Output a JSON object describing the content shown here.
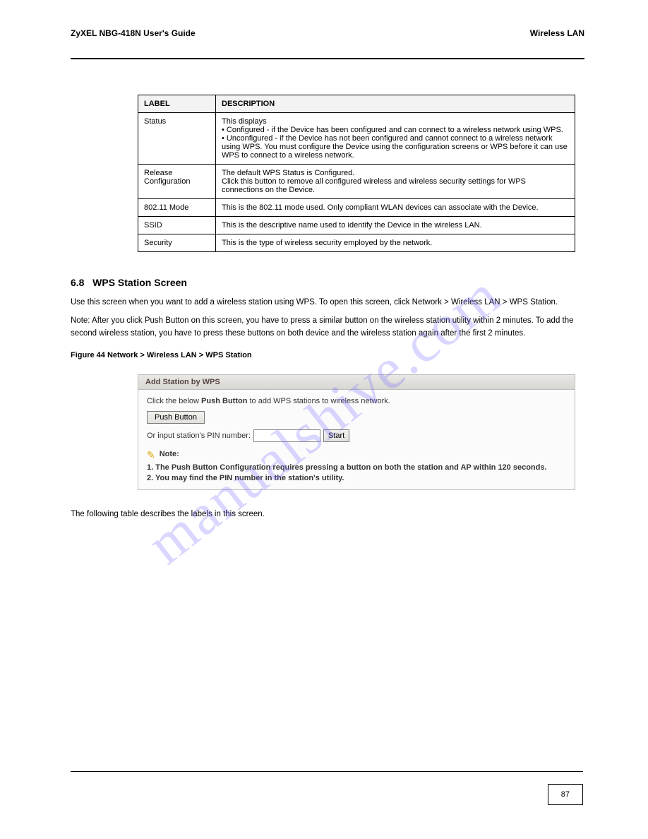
{
  "header": {
    "left": "ZyXEL NBG-418N User's Guide",
    "right": "Wireless LAN"
  },
  "table": {
    "header": {
      "c1": "LABEL",
      "c2": "DESCRIPTION"
    },
    "rows": [
      {
        "c1": "Status",
        "c2": "This displays\n• Configured - if the Device has been configured and can connect to a wireless network using WPS.\n• Unconfigured - if the Device has not been configured and cannot connect to a wireless network using WPS. You must configure the Device using the configuration screens or WPS before it can use WPS to connect to a wireless network."
      },
      {
        "c1": "Release Configuration",
        "c2": "The default WPS Status is Configured.\nClick this button to remove all configured wireless and wireless security settings for WPS connections on the Device."
      },
      {
        "c1": "802.11 Mode",
        "c2": "This is the 802.11 mode used. Only compliant WLAN devices can associate with the Device."
      },
      {
        "c1": "SSID",
        "c2": "This is the descriptive name used to identify the Device in the wireless LAN."
      },
      {
        "c1": "Security",
        "c2": "This is the type of wireless security employed by the network."
      }
    ]
  },
  "section": {
    "num": "6.8",
    "title": "WPS Station Screen",
    "body1": "Use this screen when you want to add a wireless station using WPS. To open this screen, click Network > Wireless LAN > WPS Station.",
    "body2": "Note: After you click Push Button on this screen, you have to press a similar button on the wireless station utility within 2 minutes. To add the second wireless station, you have to press these buttons on both device and the wireless station again after the first 2 minutes.",
    "figcap": "Figure 44   Network > Wireless LAN > WPS Station"
  },
  "wps": {
    "title": "Add Station by WPS",
    "line1a": "Click the below ",
    "line1b": "Push Button",
    "line1c": " to add WPS stations to wireless network.",
    "push_label": "Push Button",
    "pin_label": "Or input station's PIN number:",
    "pin_value": "",
    "start_label": "Start",
    "note_label": "Note:",
    "note1": "1. The Push Button Configuration requires pressing a button on both the station and AP within 120 seconds.",
    "note2": "2. You may find the PIN number in the station's utility."
  },
  "below": {
    "intro": "The following table describes the labels in this screen."
  },
  "pagenum": "87",
  "watermark": "manualshive.com"
}
